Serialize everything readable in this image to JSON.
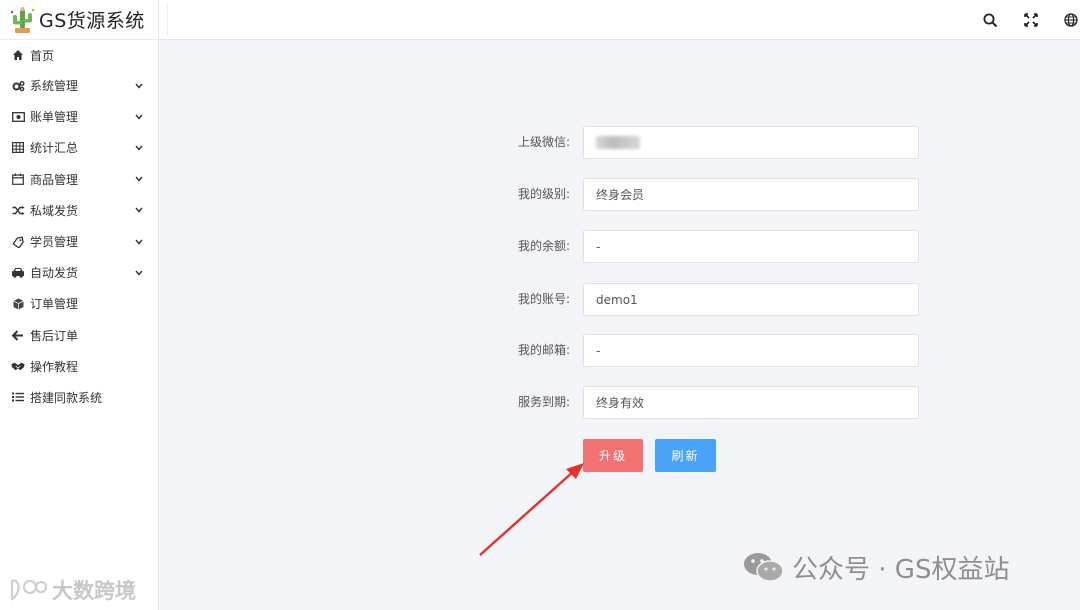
{
  "app": {
    "title": "GS货源系统"
  },
  "sidebar": {
    "items": [
      {
        "label": "首页",
        "icon": "home-icon",
        "expandable": false
      },
      {
        "label": "系统管理",
        "icon": "gears-icon",
        "expandable": true
      },
      {
        "label": "账单管理",
        "icon": "money-icon",
        "expandable": true
      },
      {
        "label": "统计汇总",
        "icon": "table-icon",
        "expandable": true
      },
      {
        "label": "商品管理",
        "icon": "calendar-icon",
        "expandable": true
      },
      {
        "label": "私域发货",
        "icon": "shuffle-icon",
        "expandable": true
      },
      {
        "label": "学员管理",
        "icon": "tag-icon",
        "expandable": true
      },
      {
        "label": "自动发货",
        "icon": "car-icon",
        "expandable": true
      },
      {
        "label": "订单管理",
        "icon": "cube-icon",
        "expandable": false
      },
      {
        "label": "售后订单",
        "icon": "arrow-left-icon",
        "expandable": false
      },
      {
        "label": "操作教程",
        "icon": "handshake-icon",
        "expandable": false
      },
      {
        "label": "搭建同款系统",
        "icon": "list-icon",
        "expandable": false
      }
    ]
  },
  "header": {
    "icons": [
      "search-icon",
      "fullscreen-icon",
      "globe-icon"
    ]
  },
  "form": {
    "fields": [
      {
        "label": "上级微信:",
        "value": "",
        "blurred": true
      },
      {
        "label": "我的级别:",
        "value": "终身会员"
      },
      {
        "label": "我的余额:",
        "value": "-"
      },
      {
        "label": "我的账号:",
        "value": "demo1"
      },
      {
        "label": "我的邮箱:",
        "value": "-"
      },
      {
        "label": "服务到期:",
        "value": "终身有效"
      }
    ],
    "upgrade_label": "升级",
    "refresh_label": "刷新"
  },
  "colors": {
    "upgrade": "#f27171",
    "refresh": "#4aa3f7",
    "arrow": "#e8302a"
  },
  "watermarks": {
    "right": "公众号 · GS权益站",
    "left": "大数跨境"
  }
}
